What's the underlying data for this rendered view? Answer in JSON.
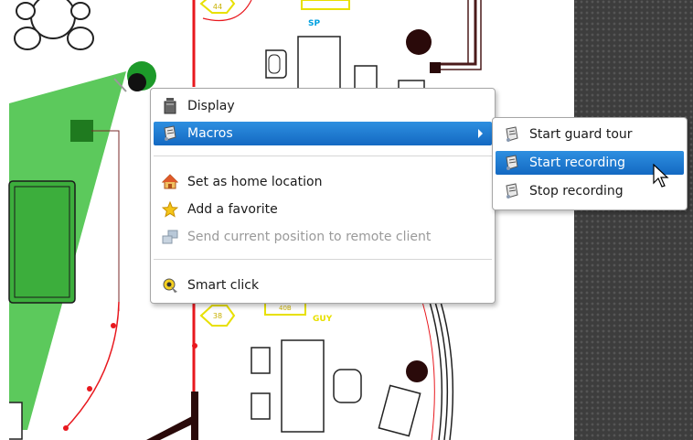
{
  "context_menu": {
    "items": [
      {
        "label": "Display",
        "icon": "display-icon"
      },
      {
        "label": "Macros",
        "icon": "macro-scroll-icon",
        "highlighted": true,
        "has_submenu": true
      },
      {
        "label": "Set as home location",
        "icon": "home-icon"
      },
      {
        "label": "Add a favorite",
        "icon": "star-icon"
      },
      {
        "label": "Send current position to remote client",
        "icon": "remote-client-icon",
        "disabled": true
      },
      {
        "label": "Smart click",
        "icon": "smart-click-icon"
      }
    ]
  },
  "submenu": {
    "items": [
      {
        "label": "Start guard tour",
        "icon": "macro-scroll-icon"
      },
      {
        "label": "Start recording",
        "icon": "macro-scroll-icon",
        "highlighted": true
      },
      {
        "label": "Stop recording",
        "icon": "macro-scroll-icon"
      }
    ]
  },
  "map_labels": {
    "room_a": "44",
    "room_b": "SP",
    "room_c": "38",
    "room_d": "GUY",
    "room_e": "40B"
  },
  "colors": {
    "highlight": "#1a78d0",
    "camera_fov": "#3fbf3f",
    "wall_red": "#e8181e",
    "wall_dark": "#4a1a1a",
    "label_yellow": "#e8e000",
    "label_cyan": "#00a0e0"
  }
}
